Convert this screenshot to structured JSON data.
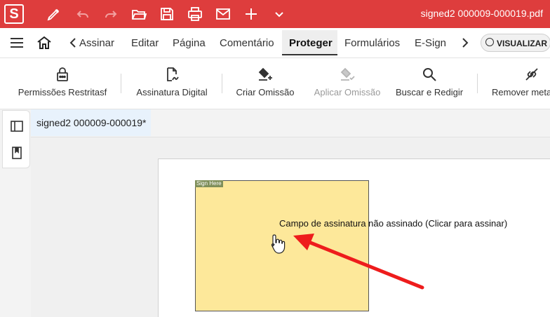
{
  "app": {
    "logo_letter": "S",
    "document_title": "signed2 000009-000019.pdf"
  },
  "menu": {
    "items": [
      "Assinar",
      "Editar",
      "Página",
      "Comentário",
      "Proteger",
      "Formulários",
      "E-Sign"
    ],
    "active": "Proteger",
    "visualizar_label": "VISUALIZAR"
  },
  "ribbon": {
    "buttons": [
      {
        "label": "Permissões Restritasf",
        "icon": "lock-icon",
        "enabled": true
      },
      {
        "label": "Assinatura Digital",
        "icon": "signature-document-icon",
        "enabled": true
      },
      {
        "label": "Criar Omissão",
        "icon": "redaction-create-icon",
        "enabled": true
      },
      {
        "label": "Aplicar Omissão",
        "icon": "redaction-apply-icon",
        "enabled": false
      },
      {
        "label": "Buscar e Redigir",
        "icon": "search-icon",
        "enabled": true
      },
      {
        "label": "Remover meta",
        "icon": "remove-metadata-icon",
        "enabled": true
      }
    ]
  },
  "tabs": [
    {
      "label": "signed2 000009-000019*"
    }
  ],
  "document": {
    "sign_tag": "Sign Here",
    "tooltip": "Campo de assinatura não assinado (Clicar para assinar)"
  },
  "colors": {
    "brand_red": "#de3d3d",
    "signature_field": "#fde89a",
    "annotation_arrow": "#ee1c1c"
  }
}
